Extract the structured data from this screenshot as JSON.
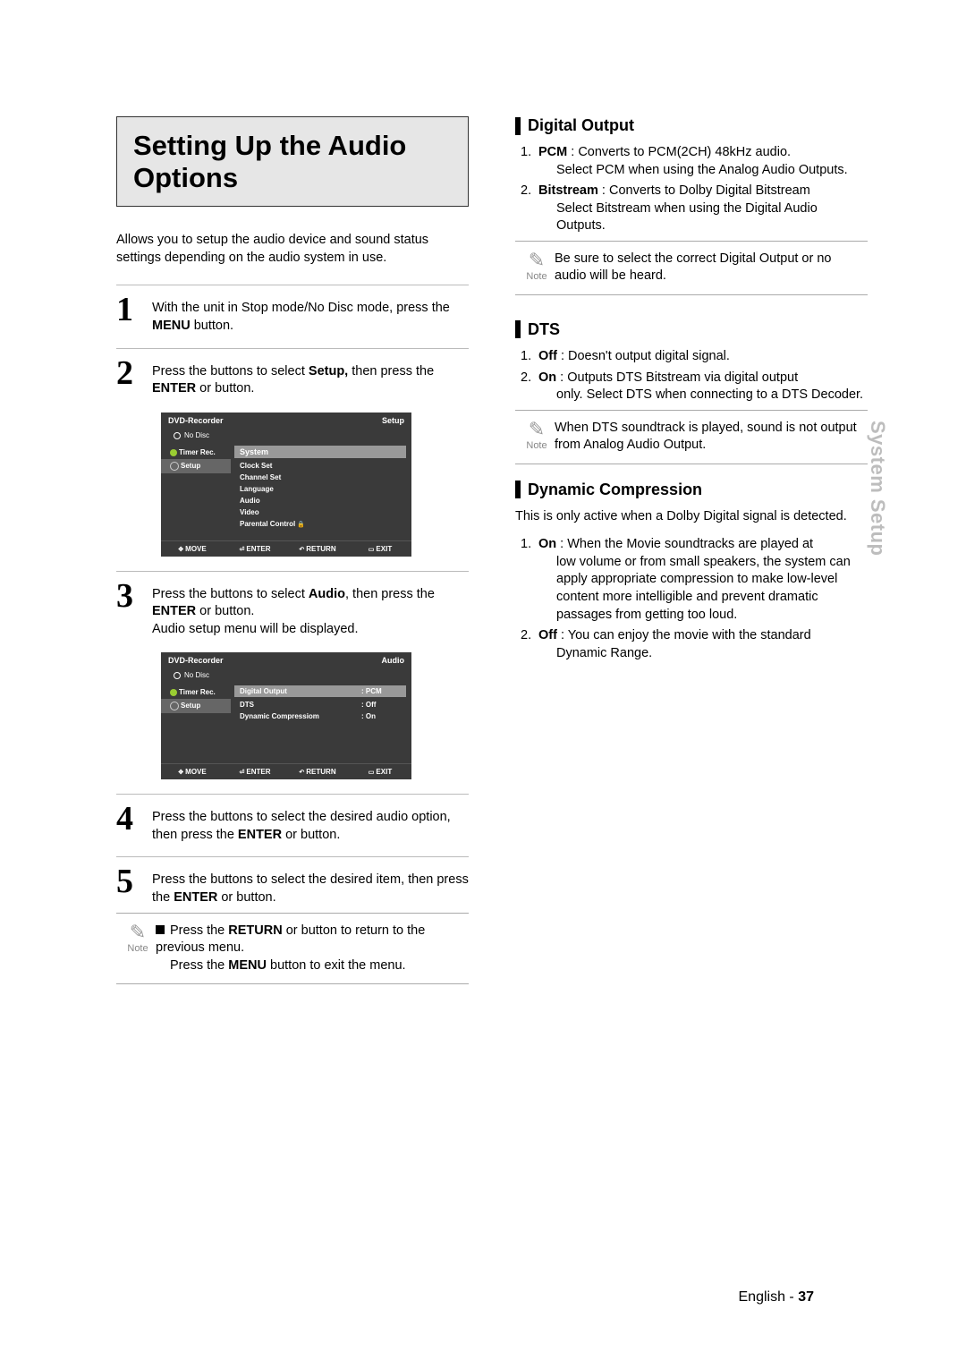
{
  "title": "Setting Up the Audio Options",
  "intro": "Allows you to setup the audio device and sound status settings depending on the audio system in use.",
  "steps": {
    "s1": {
      "n": "1",
      "pre": "With the unit in Stop mode/No Disc mode, press the ",
      "b1": "MENU",
      "post": " button."
    },
    "s2": {
      "n": "2",
      "t1": "Press the      buttons to select ",
      "b1": "Setup,",
      "t2": " then press the ",
      "b2": "ENTER",
      "t3": " or      button."
    },
    "s3": {
      "n": "3",
      "t1": "Press the      buttons to select ",
      "b1": "Audio",
      "t2": ", then press the  ",
      "b2": "ENTER",
      "t3": " or      button.",
      "line2": "Audio setup menu will be displayed."
    },
    "s4": {
      "n": "4",
      "t1": "Press the      buttons to select the desired audio option, then press the ",
      "b1": "ENTER",
      "t2": " or      button."
    },
    "s5": {
      "n": "5",
      "t1": "Press the      buttons to select the desired item, then press the ",
      "b1": "ENTER",
      "t2": " or      button."
    }
  },
  "left_note": {
    "label": "Note",
    "l1a": "Press the ",
    "l1b": "RETURN",
    "l1c": " or     button to return to the previous menu.",
    "l2a": "Press the ",
    "l2b": "MENU",
    "l2c": " button to exit the menu."
  },
  "osd1": {
    "title_left": "DVD-Recorder",
    "title_right": "Setup",
    "sub": "No Disc",
    "left": [
      "Timer Rec.",
      "Setup"
    ],
    "right_header": "System",
    "right_items": [
      "Clock Set",
      "Channel Set",
      "Language",
      "Audio",
      "Video",
      "Parental Control"
    ],
    "footer": [
      "MOVE",
      "ENTER",
      "RETURN",
      "EXIT"
    ]
  },
  "osd2": {
    "title_left": "DVD-Recorder",
    "title_right": "Audio",
    "sub": "No Disc",
    "left": [
      "Timer Rec.",
      "Setup"
    ],
    "right_header": {
      "k": "Digital Output",
      "v": ": PCM"
    },
    "right_items": [
      {
        "k": "DTS",
        "v": ": Off"
      },
      {
        "k": "Dynamic Compressiom",
        "v": ": On"
      }
    ],
    "footer": [
      "MOVE",
      "ENTER",
      "RETURN",
      "EXIT"
    ]
  },
  "digital_output": {
    "heading": "Digital Output",
    "i1": {
      "n": "1.",
      "b": "PCM",
      "t": " : Converts to PCM(2CH) 48kHz audio.",
      "indent": "Select PCM when using the Analog Audio Outputs."
    },
    "i2": {
      "n": "2.",
      "b": "Bitstream",
      "t": " : Converts to Dolby Digital Bitstream",
      "indent": "Select Bitstream when using the Digital Audio Outputs."
    },
    "note_label": "Note",
    "note": "Be sure to select the correct Digital Output or no audio will be heard."
  },
  "dts": {
    "heading": "DTS",
    "i1": {
      "n": "1.",
      "b": "Off",
      "t": " : Doesn't output digital signal."
    },
    "i2": {
      "n": "2.",
      "b": "On",
      "t": " : Outputs DTS Bitstream via digital output",
      "indent": "only. Select DTS when connecting to a DTS Decoder."
    },
    "note_label": "Note",
    "note": "When DTS soundtrack is played, sound is not output from Analog Audio Output."
  },
  "dyn": {
    "heading": "Dynamic Compression",
    "intro": "This is only active when a Dolby Digital signal is detected.",
    "i1": {
      "n": "1.",
      "b": "On",
      "t": " : When the Movie soundtracks are played at",
      "indent": "low volume or from small speakers, the system can apply appropriate compression to make low-level content more intelligible and prevent dramatic passages from getting too loud."
    },
    "i2": {
      "n": "2.",
      "b": "Off",
      "t": " : You can enjoy the movie with the standard",
      "indent": "Dynamic Range."
    }
  },
  "edge_tab": "System Setup",
  "footer": {
    "lang": "English - ",
    "page": "37"
  }
}
